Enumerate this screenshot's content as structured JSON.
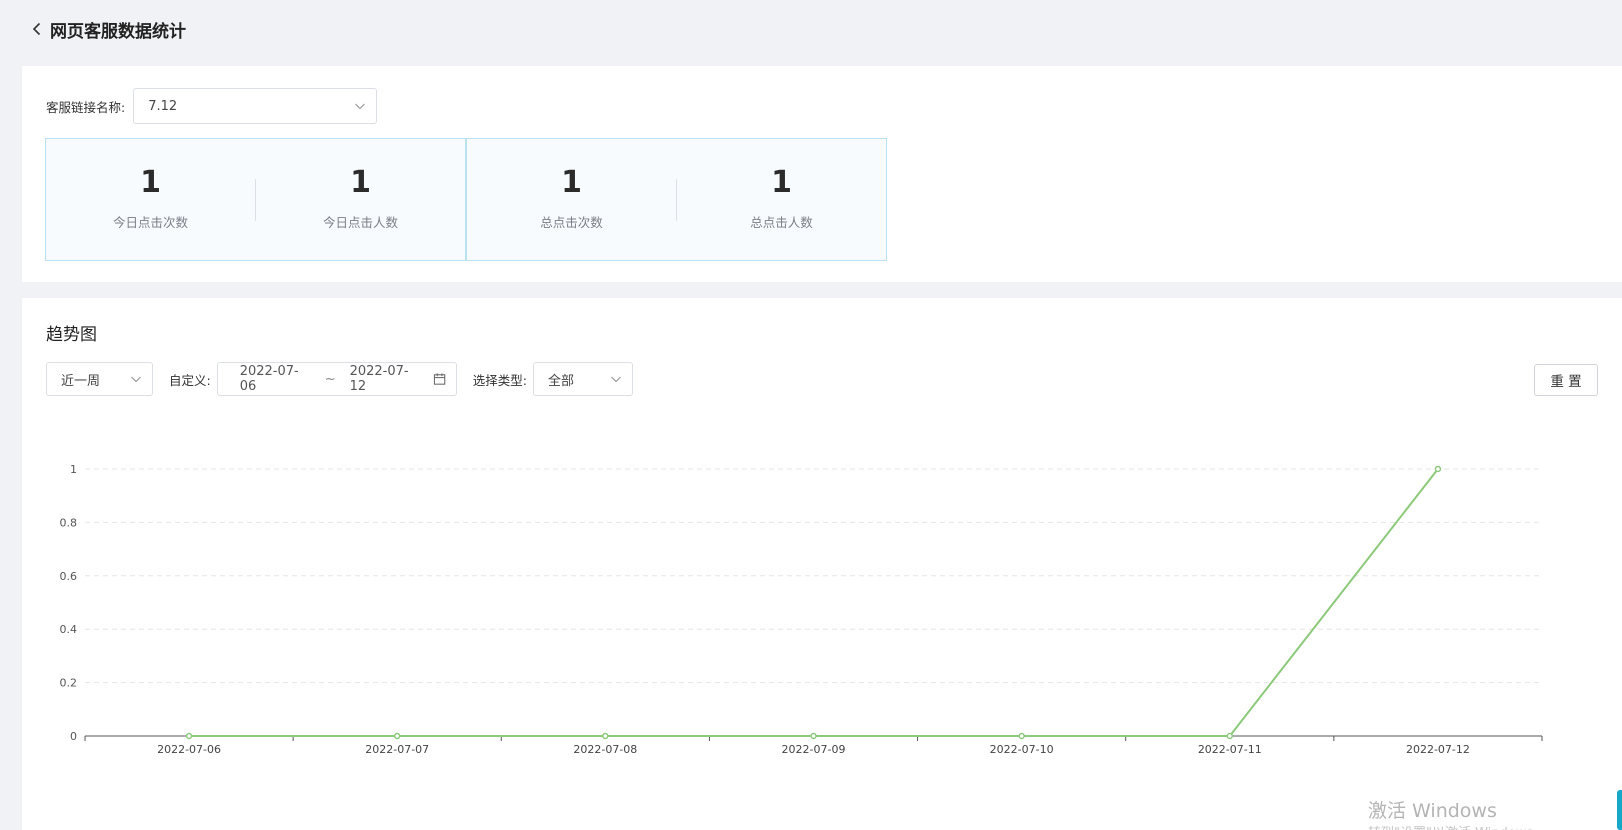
{
  "header": {
    "title": "网页客服数据统计"
  },
  "link_filter": {
    "label": "客服链接名称:",
    "value": "7.12"
  },
  "stats": [
    {
      "value": "1",
      "label": "今日点击次数"
    },
    {
      "value": "1",
      "label": "今日点击人数"
    },
    {
      "value": "1",
      "label": "总点击次数"
    },
    {
      "value": "1",
      "label": "总点击人数"
    }
  ],
  "trend": {
    "title": "趋势图",
    "period_value": "近一周",
    "custom_label": "自定义:",
    "date_start": "2022-07-06",
    "date_sep": "~",
    "date_end": "2022-07-12",
    "type_label": "选择类型:",
    "type_value": "全部",
    "reset_label": "重 置"
  },
  "chart_data": {
    "type": "line",
    "categories": [
      "2022-07-06",
      "2022-07-07",
      "2022-07-08",
      "2022-07-09",
      "2022-07-10",
      "2022-07-11",
      "2022-07-12"
    ],
    "series": [
      {
        "values": [
          0,
          0,
          0,
          0,
          0,
          0,
          1
        ],
        "color": "#8cc97a"
      }
    ],
    "yticks": [
      "0",
      "0.2",
      "0.4",
      "0.6",
      "0.8",
      "1"
    ],
    "ylim": [
      0,
      1
    ],
    "grid": true,
    "title": "",
    "xlabel": "",
    "ylabel": ""
  },
  "watermark": {
    "line1": "激活 Windows",
    "line2": "转到\"设置\"以激活 Windows。"
  },
  "colors": {
    "line": "#8cc97a",
    "card_border": "#b9e1f0",
    "page_bg": "#f0f2f5",
    "edge_tab": "#16a7c9"
  }
}
